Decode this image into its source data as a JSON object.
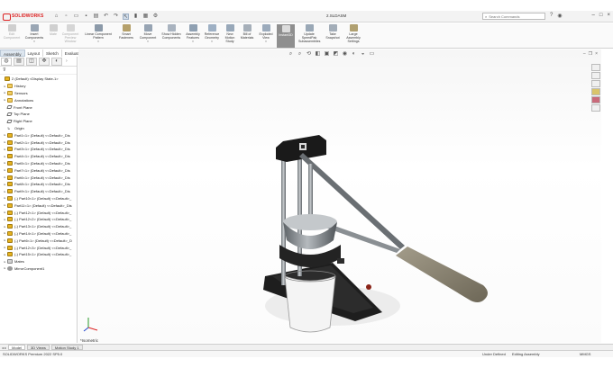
{
  "app": {
    "logo_text": "SOLIDWORKS",
    "document_title": "2.SLDASM"
  },
  "search": {
    "placeholder": "Search Commands"
  },
  "ribbon": {
    "buttons": [
      {
        "label": "Edit Component",
        "state": "disabled"
      },
      {
        "label": "Insert Components",
        "state": "normal"
      },
      {
        "label": "Mate",
        "state": "disabled"
      },
      {
        "label": "Component Preview Window",
        "state": "disabled"
      },
      {
        "label": "Linear Component Pattern",
        "state": "normal"
      },
      {
        "label": "Smart Fasteners",
        "state": "normal"
      },
      {
        "label": "Move Component",
        "state": "normal"
      },
      {
        "label": "Show Hidden Components",
        "state": "normal"
      },
      {
        "label": "Assembly Features",
        "state": "normal"
      },
      {
        "label": "Reference Geometry",
        "state": "normal"
      },
      {
        "label": "New Motion Study",
        "state": "normal"
      },
      {
        "label": "Bill of Materials",
        "state": "normal"
      },
      {
        "label": "Exploded View",
        "state": "normal"
      },
      {
        "label": "Instant3D",
        "state": "active"
      },
      {
        "label": "Update SpeedPak Subassemblies",
        "state": "normal"
      },
      {
        "label": "Take Snapshot",
        "state": "normal"
      },
      {
        "label": "Large Assembly Settings",
        "state": "normal"
      }
    ]
  },
  "command_tabs": [
    "Assembly",
    "Layout",
    "Sketch",
    "Evaluate"
  ],
  "feature_tree": {
    "root": "2 (Default) <Display State-1>",
    "items": [
      {
        "label": "History",
        "icon": "folder",
        "level": 1
      },
      {
        "label": "Sensors",
        "icon": "folder",
        "level": 1
      },
      {
        "label": "Annotations",
        "icon": "folder",
        "level": 1
      },
      {
        "label": "Front Plane",
        "icon": "plane",
        "level": 1
      },
      {
        "label": "Top Plane",
        "icon": "plane",
        "level": 1
      },
      {
        "label": "Right Plane",
        "icon": "plane",
        "level": 1
      },
      {
        "label": "Origin",
        "icon": "origin",
        "level": 1
      },
      {
        "label": "Part1<1> (Default) <<Default>_Dis",
        "icon": "part",
        "level": 1
      },
      {
        "label": "Part2<1> (Default) <<Default>_Dis",
        "icon": "part",
        "level": 1
      },
      {
        "label": "Part3<1> (Default) <<Default>_Dis",
        "icon": "part",
        "level": 1
      },
      {
        "label": "Part4<1> (Default) <<Default>_Dis",
        "icon": "part",
        "level": 1
      },
      {
        "label": "Part5<1> (Default) <<Default>_Dis",
        "icon": "part",
        "level": 1
      },
      {
        "label": "Part7<1> (Default) <<Default>_Dis",
        "icon": "part",
        "level": 1
      },
      {
        "label": "Part6<1> (Default) <<Default>_Dis",
        "icon": "part",
        "level": 1
      },
      {
        "label": "Part8<1> (Default) <<Default>_Dis",
        "icon": "part",
        "level": 1
      },
      {
        "label": "Part9<1> (Default) <<Default>_Dis",
        "icon": "part",
        "level": 1
      },
      {
        "label": "(-) Part10<1> (Default) <<Default>_",
        "icon": "part",
        "level": 1
      },
      {
        "label": "Part11<1> (Default) <<Default>_Dis",
        "icon": "part",
        "level": 1
      },
      {
        "label": "(-) Part12<1> (Default) <<Default>_",
        "icon": "part",
        "level": 1
      },
      {
        "label": "(-) Part12<2> (Default) <<Default>_",
        "icon": "part",
        "level": 1
      },
      {
        "label": "(-) Part13<1> (Default) <<Default>_",
        "icon": "part",
        "level": 1
      },
      {
        "label": "(-) Part14<1> (Default) <<Default>_",
        "icon": "part",
        "level": 1
      },
      {
        "label": "(-) Part6<1> (Default) <<Default>_D",
        "icon": "part",
        "level": 1
      },
      {
        "label": "(-) Part12<3> (Default) <<Default>_",
        "icon": "part",
        "level": 1
      },
      {
        "label": "(-) Part15<1> (Default) <<Default>_",
        "icon": "part",
        "level": 1
      },
      {
        "label": "Mates",
        "icon": "mates",
        "level": 1
      },
      {
        "label": "MirrorComponent1",
        "icon": "gear",
        "level": 1
      }
    ]
  },
  "viewport": {
    "view_label": "*Isometric"
  },
  "bottom_tabs": [
    "Model",
    "3D Views",
    "Motion Study 1"
  ],
  "status": {
    "product": "SOLIDWORKS Premium 2022 SP5.0",
    "definition": "Under Defined",
    "mode": "Editing Assembly",
    "units": "MMGS"
  }
}
